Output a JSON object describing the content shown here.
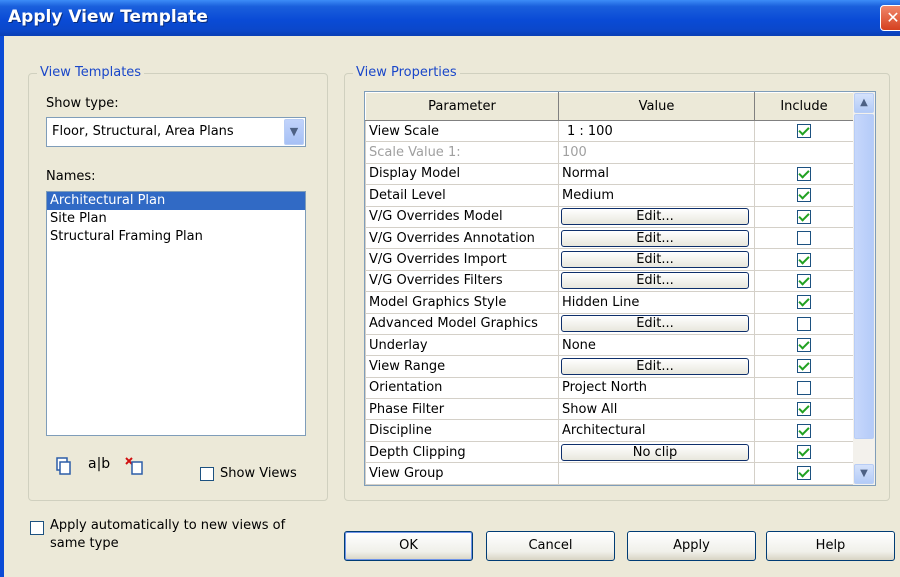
{
  "window": {
    "title": "Apply View Template",
    "close_glyph": "✕"
  },
  "templates": {
    "legend": "View Templates",
    "show_type_label": "Show type:",
    "show_type_value": "Floor, Structural, Area Plans",
    "names_label": "Names:",
    "names": [
      "Architectural Plan",
      "Site Plan",
      "Structural Framing Plan"
    ],
    "selected_index": 0,
    "rename_icon_text": "a|b",
    "show_views_label": "Show Views",
    "show_views_checked": false
  },
  "properties": {
    "legend": "View Properties",
    "columns": [
      "Parameter",
      "Value",
      "Include"
    ],
    "rows": [
      {
        "param": "View Scale",
        "value": "1 : 100",
        "type": "text",
        "include": true
      },
      {
        "param": "Scale Value    1:",
        "value": "100",
        "type": "text",
        "include": null,
        "dim": true
      },
      {
        "param": "Display Model",
        "value": "Normal",
        "type": "text",
        "include": true
      },
      {
        "param": "Detail Level",
        "value": "Medium",
        "type": "text",
        "include": true
      },
      {
        "param": "V/G Overrides Model",
        "value": "Edit...",
        "type": "button",
        "include": true
      },
      {
        "param": "V/G Overrides Annotation",
        "value": "Edit...",
        "type": "button",
        "include": false
      },
      {
        "param": "V/G Overrides Import",
        "value": "Edit...",
        "type": "button",
        "include": true
      },
      {
        "param": "V/G Overrides Filters",
        "value": "Edit...",
        "type": "button",
        "include": true
      },
      {
        "param": "Model Graphics Style",
        "value": "Hidden Line",
        "type": "text",
        "include": true
      },
      {
        "param": "Advanced Model Graphics",
        "value": "Edit...",
        "type": "button",
        "include": false
      },
      {
        "param": "Underlay",
        "value": "None",
        "type": "text",
        "include": true
      },
      {
        "param": "View Range",
        "value": "Edit...",
        "type": "button",
        "include": true
      },
      {
        "param": "Orientation",
        "value": "Project North",
        "type": "text",
        "include": false
      },
      {
        "param": "Phase Filter",
        "value": "Show All",
        "type": "text",
        "include": true
      },
      {
        "param": "Discipline",
        "value": "Architectural",
        "type": "text",
        "include": true
      },
      {
        "param": "Depth Clipping",
        "value": "No clip",
        "type": "button",
        "include": true
      },
      {
        "param": "View Group",
        "value": "",
        "type": "text",
        "include": true
      }
    ]
  },
  "footer": {
    "apply_auto_label": "Apply automatically to new views of same type",
    "apply_auto_checked": false,
    "ok": "OK",
    "cancel": "Cancel",
    "apply": "Apply",
    "help": "Help"
  }
}
